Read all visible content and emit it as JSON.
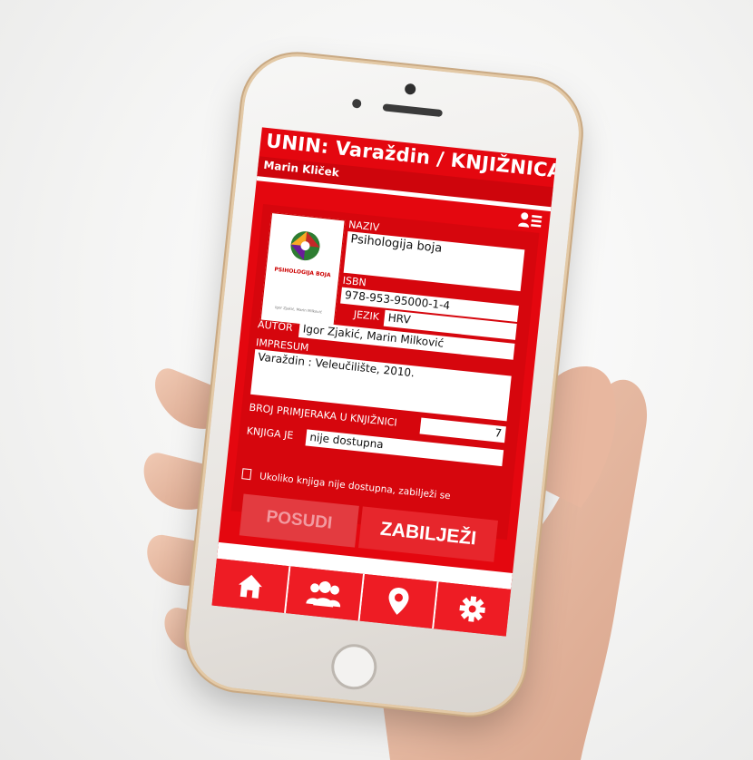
{
  "app": {
    "title": "UNIN: Varaždin / KNJIŽNICA",
    "user": "Marin Kliček"
  },
  "book": {
    "cover_title": "PSIHOLOGIJA BOJA",
    "labels": {
      "naziv": "NAZIV",
      "isbn": "ISBN",
      "jezik": "JEZIK",
      "autor": "AUTOR",
      "impresum": "IMPRESUM",
      "broj": "BROJ PRIMJERAKA U KNJIŽNICI",
      "status": "KNJIGA JE"
    },
    "naziv": "Psihologija boja",
    "isbn": "978-953-95000-1-4",
    "jezik": "HRV",
    "autor": "Igor Zjakić, Marin Milković",
    "impresum": "Varaždin : Veleučilište, 2010.",
    "broj_primjeraka": "7",
    "status": "nije dostupna",
    "note": "Ukoliko knjiga nije dostupna, zabilježi se"
  },
  "actions": {
    "posudi": "POSUDI",
    "zabiljezi": "ZABILJEŽI"
  },
  "tabbar": {
    "items": [
      {
        "icon": "home-icon"
      },
      {
        "icon": "users-icon"
      },
      {
        "icon": "location-pin-icon"
      },
      {
        "icon": "gear-icon"
      }
    ]
  },
  "colors": {
    "primary_red": "#e4070f",
    "panel_red": "#d6060d",
    "tab_red": "#ee1c24"
  }
}
